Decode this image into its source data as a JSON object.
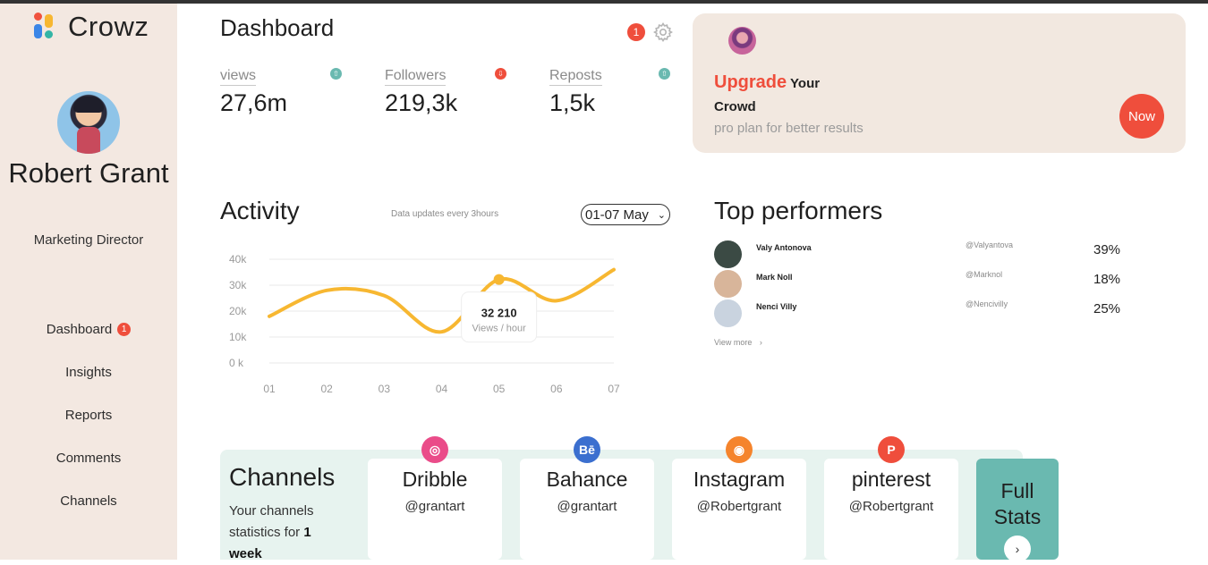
{
  "app": {
    "name": "Crowz"
  },
  "profile": {
    "name": "Robert Grant",
    "role": "Marketing Director"
  },
  "nav": {
    "items": [
      {
        "label": "Dashboard",
        "badge": "1"
      },
      {
        "label": "Insights"
      },
      {
        "label": "Reports"
      },
      {
        "label": "Comments"
      },
      {
        "label": "Channels"
      }
    ]
  },
  "header": {
    "title": "Dashboard",
    "notification_count": "1",
    "settings_icon": "gear-icon"
  },
  "stats": [
    {
      "label": "views",
      "value": "27,6m",
      "trend": "up",
      "color": "#6ab9b0"
    },
    {
      "label": "Followers",
      "value": "219,3k",
      "trend": "down",
      "color": "#ef4e3c"
    },
    {
      "label": "Reposts",
      "value": "1,5k",
      "trend": "up",
      "color": "#6ab9b0"
    }
  ],
  "upgrade": {
    "highlight": "Upgrade",
    "rest_line1": "Your",
    "line2": "Crowd",
    "subtitle": "pro plan for better results",
    "button": "Now"
  },
  "activity": {
    "title": "Activity",
    "note": "Data updates every 3hours",
    "date_range": "01-07 May",
    "tooltip_value": "32 210",
    "tooltip_label": "Views / hour"
  },
  "chart_data": {
    "type": "line",
    "x": [
      "01",
      "02",
      "03",
      "04",
      "05",
      "06",
      "07"
    ],
    "y_ticks": [
      "0 k",
      "10k",
      "20k",
      "30k",
      "40k"
    ],
    "ylim": [
      0,
      40000
    ],
    "series": [
      {
        "values": [
          18000,
          28000,
          26000,
          12000,
          32210,
          24000,
          36000
        ]
      }
    ],
    "highlight_index": 4,
    "grid": true,
    "color": "#f7b731"
  },
  "performers": {
    "title": "Top performers",
    "rows": [
      {
        "name": "Valy Antonova",
        "handle": "@Valyantova",
        "pct": "39%",
        "avatar_color": "#3b4a44"
      },
      {
        "name": "Mark Noll",
        "handle": "@Marknol",
        "pct": "18%",
        "avatar_color": "#d8b59a"
      },
      {
        "name": "Nenci Villy",
        "handle": "@Nencivilly",
        "pct": "25%",
        "avatar_color": "#c9d3df"
      }
    ],
    "view_more": "View more"
  },
  "channels": {
    "title": "Channels",
    "desc_prefix": "Your channels statistics for ",
    "desc_bold": "1 week",
    "items": [
      {
        "name": "Dribble",
        "handle": "@grantart",
        "icon": "dribbble-icon",
        "glyph": "◎",
        "color": "#ea4c89"
      },
      {
        "name": "Bahance",
        "handle": "@grantart",
        "icon": "behance-icon",
        "glyph": "Bē",
        "color": "#3b6fcf"
      },
      {
        "name": "Instagram",
        "handle": "@Robertgrant",
        "icon": "instagram-icon",
        "glyph": "◉",
        "color": "#f5842c"
      },
      {
        "name": "pinterest",
        "handle": "@Robertgrant",
        "icon": "pinterest-icon",
        "glyph": "P",
        "color": "#ef4e3c"
      }
    ],
    "full_stats": "Full Stats"
  }
}
